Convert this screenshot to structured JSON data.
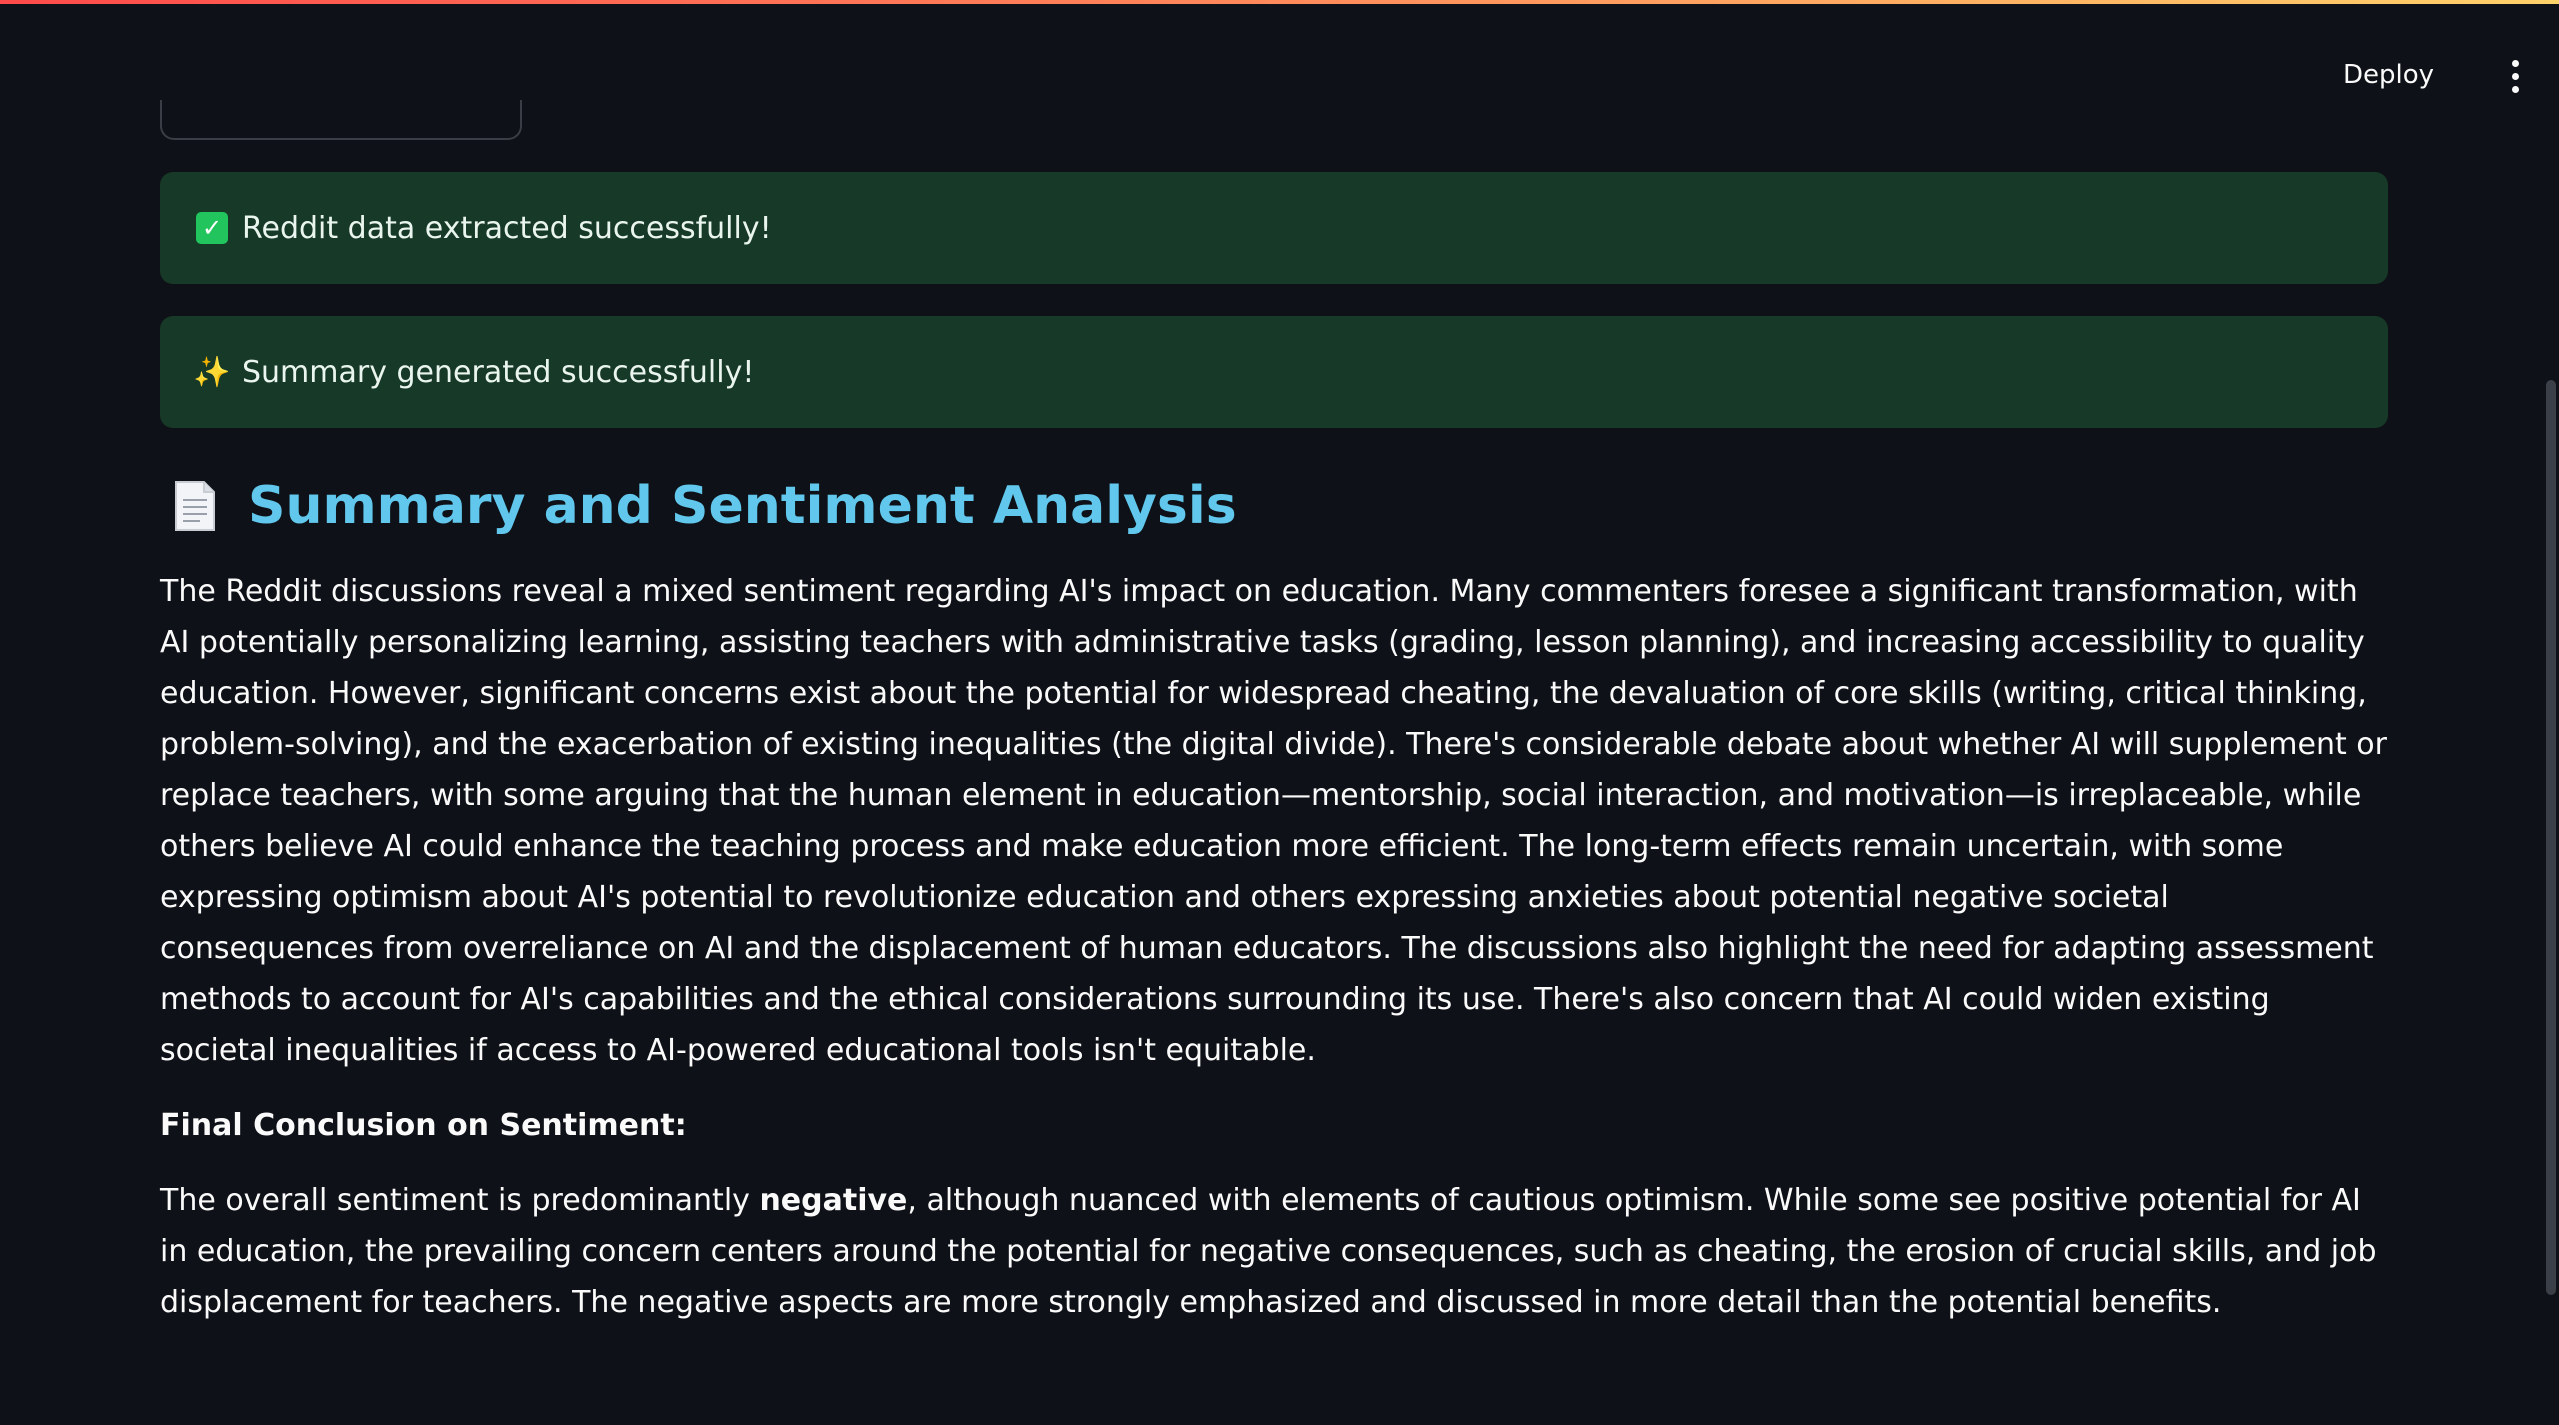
{
  "header": {
    "deploy_label": "Deploy",
    "menu_icon": "more-vertical-icon"
  },
  "alerts": [
    {
      "icon": "check-icon",
      "text": "Reddit data extracted successfully!"
    },
    {
      "icon": "sparkle-icon",
      "text": "Summary generated successfully!"
    }
  ],
  "section": {
    "icon": "document-icon",
    "title": "Summary and Sentiment Analysis",
    "summary": "The Reddit discussions reveal a mixed sentiment regarding AI's impact on education. Many commenters foresee a significant transformation, with AI potentially personalizing learning, assisting teachers with administrative tasks (grading, lesson planning), and increasing accessibility to quality education. However, significant concerns exist about the potential for widespread cheating, the devaluation of core skills (writing, critical thinking, problem-solving), and the exacerbation of existing inequalities (the digital divide). There's considerable debate about whether AI will supplement or replace teachers, with some arguing that the human element in education—mentorship, social interaction, and motivation—is irreplaceable, while others believe AI could enhance the teaching process and make education more efficient. The long-term effects remain uncertain, with some expressing optimism about AI's potential to revolutionize education and others expressing anxieties about potential negative societal consequences from overreliance on AI and the displacement of human educators. The discussions also highlight the need for adapting assessment methods to account for AI's capabilities and the ethical considerations surrounding its use. There's also concern that AI could widen existing societal inequalities if access to AI-powered educational tools isn't equitable.",
    "conclusion_heading": "Final Conclusion on Sentiment:",
    "conclusion_prefix": "The overall sentiment is predominantly ",
    "conclusion_emphasis": "negative",
    "conclusion_rest": ", although nuanced with elements of cautious optimism. While some see positive potential for AI in education, the prevailing concern centers around the potential for negative consequences, such as cheating, the erosion of crucial skills, and job displacement for teachers. The negative aspects are more strongly emphasized and discussed in more detail than the potential benefits."
  },
  "colors": {
    "background": "#0e1117",
    "alert_background": "#173928",
    "heading": "#61c7ec"
  }
}
